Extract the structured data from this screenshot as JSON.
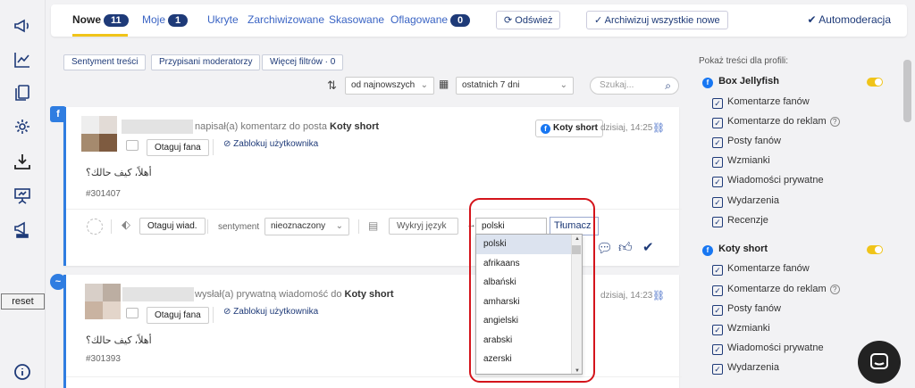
{
  "tabs": [
    {
      "label": "Nowe",
      "count": "11"
    },
    {
      "label": "Moje",
      "count": "1"
    },
    {
      "label": "Ukryte"
    },
    {
      "label": "Zarchiwizowane"
    },
    {
      "label": "Skasowane"
    },
    {
      "label": "Oflagowane",
      "count": "0"
    }
  ],
  "topbar": {
    "refresh": "Odśwież",
    "archive_all": "Archiwizuj wszystkie nowe",
    "automod": "Automoderacja"
  },
  "filters": {
    "sentiment": "Sentyment treści",
    "moderators": "Przypisani moderatorzy",
    "more": "Więcej filtrów · 0",
    "sort": "od najnowszych",
    "range": "ostatnich 7 dni",
    "search_placeholder": "Szukaj..."
  },
  "sidebar": {
    "reset": "reset"
  },
  "posts": [
    {
      "headline_pre": "napisał(a) komentarz do posta",
      "headline_target": "Koty short",
      "page": "Koty short",
      "time": "dzisiaj, 14:25",
      "tag_fan": "Otaguj fana",
      "block_user": "Zablokuj użytkownika",
      "message": "أهلاً، كيف حالك؟",
      "id": "#301407",
      "tag_msg": "Otaguj wiad.",
      "sentiment_label": "sentyment",
      "sentiment_value": "nieoznaczony",
      "detect_lang": "Wykryj język"
    },
    {
      "headline_pre": "wysłał(a) prywatną wiadomość do",
      "headline_target": "Koty short",
      "time": "dzisiaj, 14:23",
      "tag_fan": "Otaguj fana",
      "block_user": "Zablokuj użytkownika",
      "message": "أهلاً، كيف حالك؟",
      "id": "#301393"
    }
  ],
  "translate": {
    "input_value": "polski",
    "button": "Tłumacz",
    "options": [
      "polski",
      "afrikaans",
      "albański",
      "amharski",
      "angielski",
      "arabski",
      "azerski"
    ]
  },
  "right_panel": {
    "title": "Pokaż treści dla profili:",
    "profiles": [
      {
        "name": "Box Jellyfish",
        "items": [
          "Komentarze fanów",
          "Komentarze do reklam",
          "Posty fanów",
          "Wzmianki",
          "Wiadomości prywatne",
          "Wydarzenia",
          "Recenzje"
        ]
      },
      {
        "name": "Koty short",
        "items": [
          "Komentarze fanów",
          "Komentarze do reklam",
          "Posty fanów",
          "Wzmianki",
          "Wiadomości prywatne",
          "Wydarzenia"
        ]
      }
    ]
  },
  "colors": {
    "accent": "#1e3a78",
    "highlight": "#d4141b",
    "toggle": "#f0c419",
    "facebook": "#2f7de1"
  }
}
